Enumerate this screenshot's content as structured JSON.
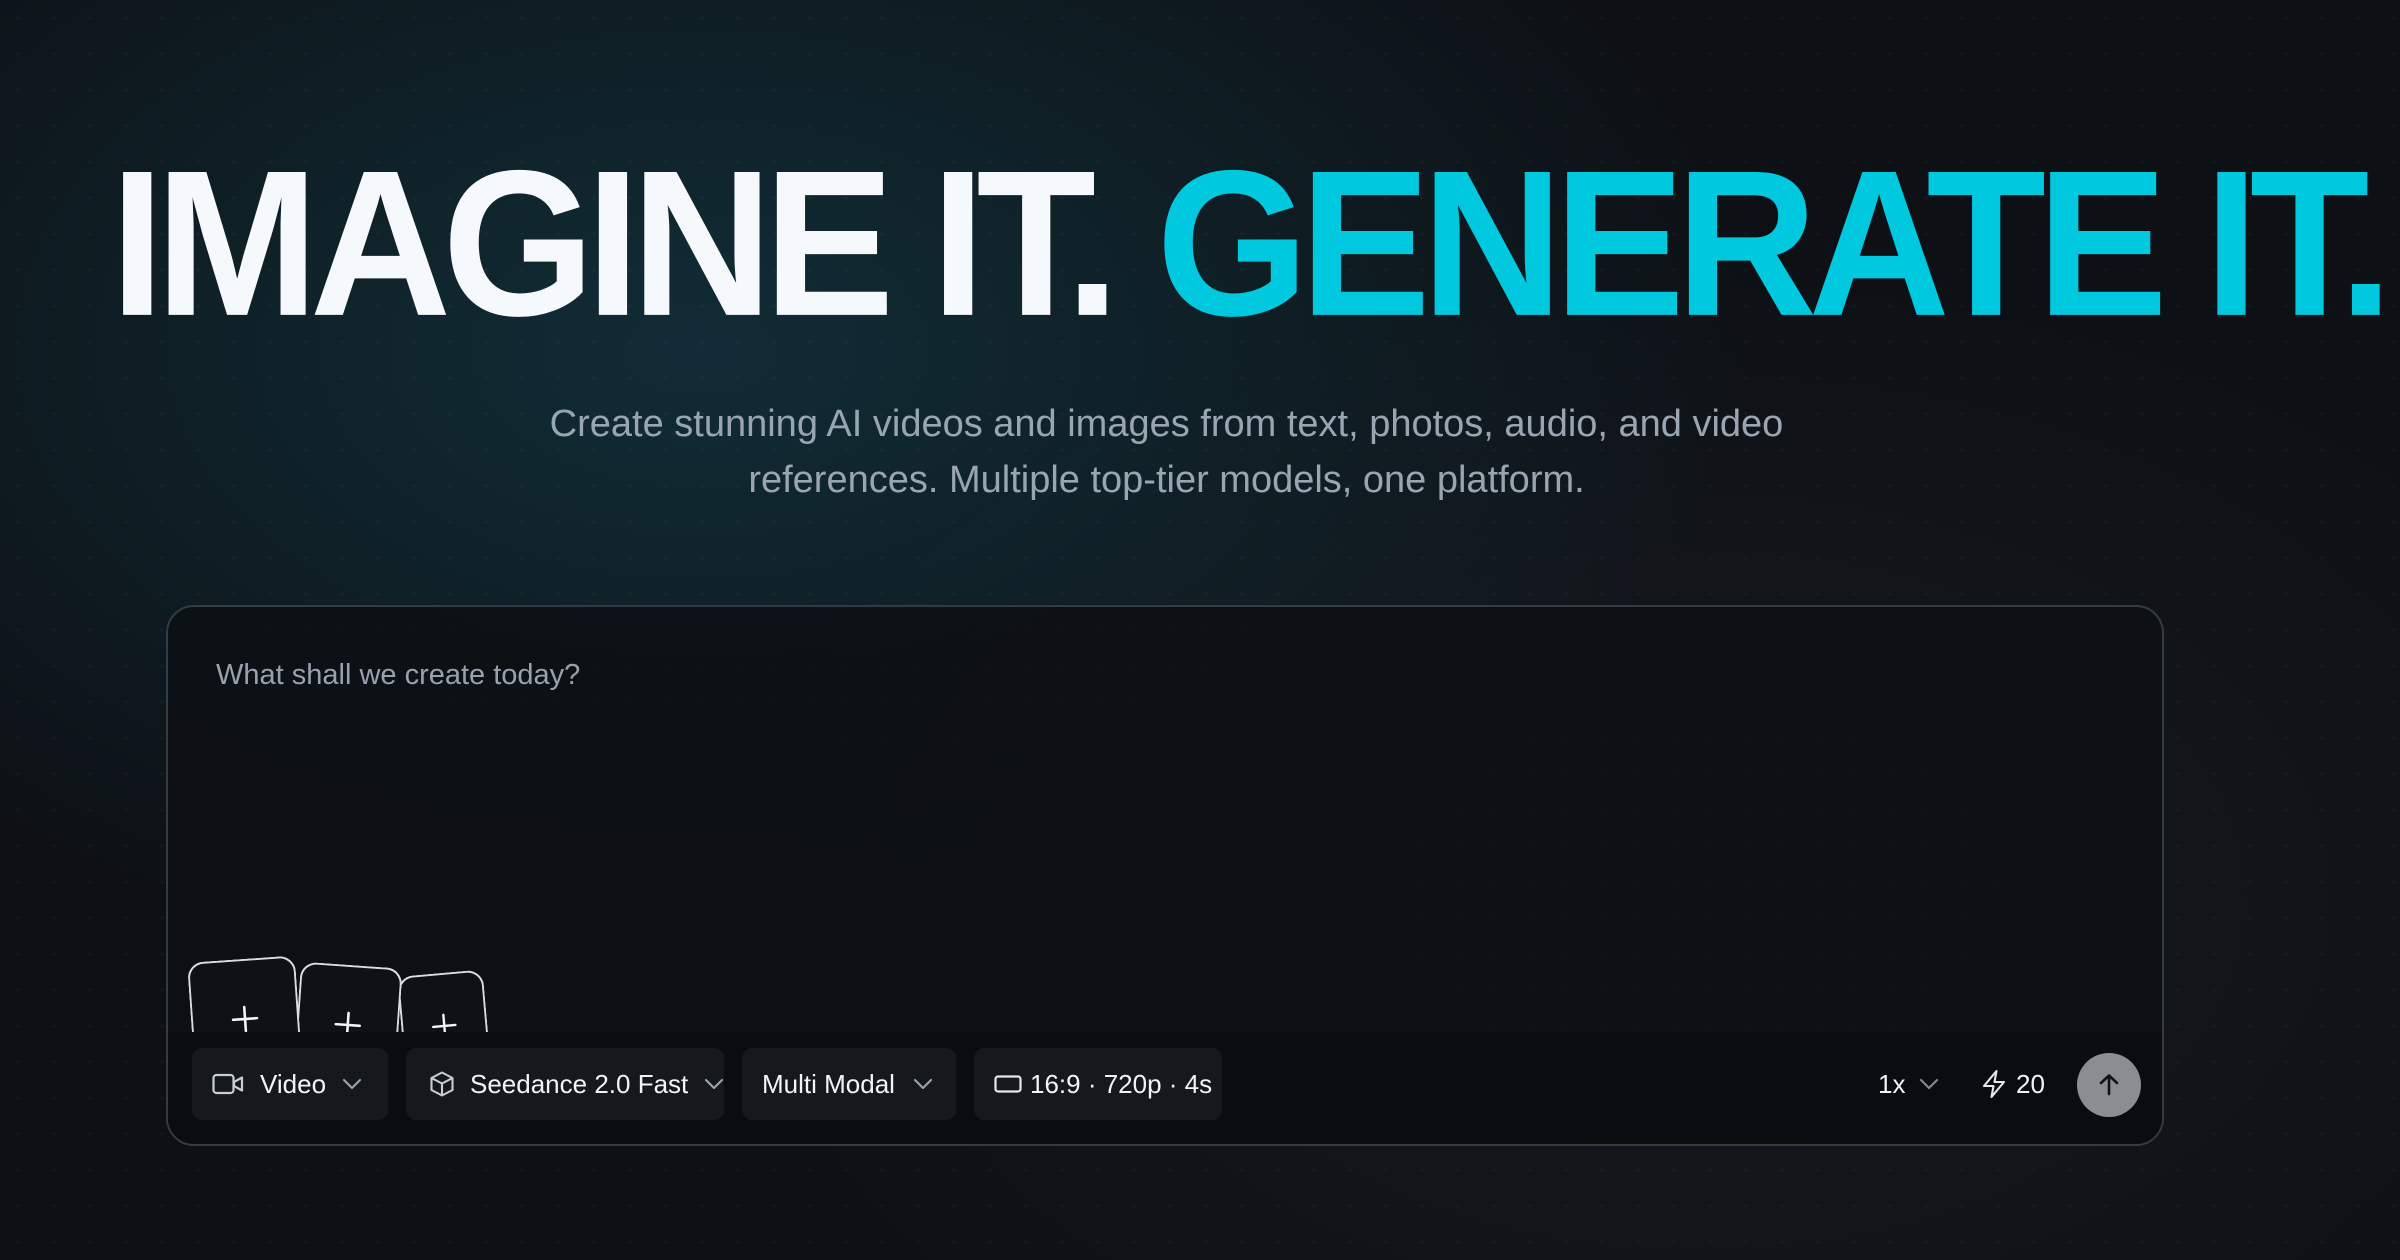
{
  "hero": {
    "headline_part1": "IMAGINE IT.",
    "headline_part2": "GENERATE IT.",
    "subtitle_line1": "Create stunning AI videos and images from text, photos, audio, and video",
    "subtitle_line2": "references. Multiple top-tier models, one platform."
  },
  "prompt": {
    "placeholder": "What shall we create today?",
    "value": ""
  },
  "uploads": [
    {
      "icon": "plus-icon"
    },
    {
      "icon": "plus-icon"
    },
    {
      "icon": "plus-icon"
    }
  ],
  "toolbar": {
    "media_type": {
      "icon": "video-camera-icon",
      "label": "Video"
    },
    "model": {
      "icon": "cube-icon",
      "label": "Seedance 2.0 Fast"
    },
    "mode": {
      "label": "Multi Modal"
    },
    "format": {
      "icon": "aspect-ratio-icon",
      "label": "16:9 · 720p · 4s"
    },
    "speed": {
      "label": "1x"
    },
    "credits": {
      "icon": "lightning-icon",
      "label": "20"
    },
    "send": {
      "icon": "arrow-up-icon"
    }
  },
  "colors": {
    "accent": "#00c8de",
    "background": "#0d1115",
    "send_button": "#8a8e93"
  }
}
